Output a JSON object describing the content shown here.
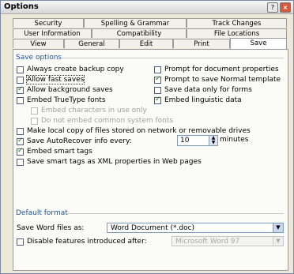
{
  "window": {
    "title": "Options",
    "help_icon": "?",
    "close_icon": "×"
  },
  "tabs": {
    "row1": [
      "Security",
      "Spelling & Grammar",
      "Track Changes"
    ],
    "row2": [
      "User Information",
      "Compatibility",
      "File Locations"
    ],
    "row3": [
      "View",
      "General",
      "Edit",
      "Print",
      "Save"
    ],
    "active": "Save"
  },
  "save_options": {
    "label": "Save options",
    "always_backup": {
      "label": "Always create backup copy",
      "checked": false
    },
    "prompt_doc_props": {
      "label": "Prompt for document properties",
      "checked": false
    },
    "allow_fast_saves": {
      "label": "Allow fast saves",
      "checked": false
    },
    "prompt_normal": {
      "label": "Prompt to save Normal template",
      "checked": true
    },
    "allow_background": {
      "label": "Allow background saves",
      "checked": true
    },
    "save_data_forms": {
      "label": "Save data only for forms",
      "checked": false
    },
    "embed_truetype": {
      "label": "Embed TrueType fonts",
      "checked": false
    },
    "embed_linguistic": {
      "label": "Embed linguistic data",
      "checked": true
    },
    "embed_chars_in_use": {
      "label": "Embed characters in use only",
      "checked": false
    },
    "no_embed_system": {
      "label": "Do not embed common system fonts",
      "checked": false
    },
    "local_copy": {
      "label": "Make local copy of files stored on network or removable drives",
      "checked": false
    },
    "autorecover": {
      "label": "Save AutoRecover info every:",
      "checked": true,
      "value": "10",
      "unit": "minutes"
    },
    "embed_smart_tags": {
      "label": "Embed smart tags",
      "checked": true
    },
    "smart_tags_xml": {
      "label": "Save smart tags as XML properties in Web pages",
      "checked": false
    }
  },
  "default_format": {
    "label": "Default format",
    "save_as_label": "Save Word files as:",
    "save_as_value": "Word Document (*.doc)",
    "disable_features": {
      "label": "Disable features introduced after:",
      "checked": false
    },
    "disable_after_value": "Microsoft Word 97"
  }
}
